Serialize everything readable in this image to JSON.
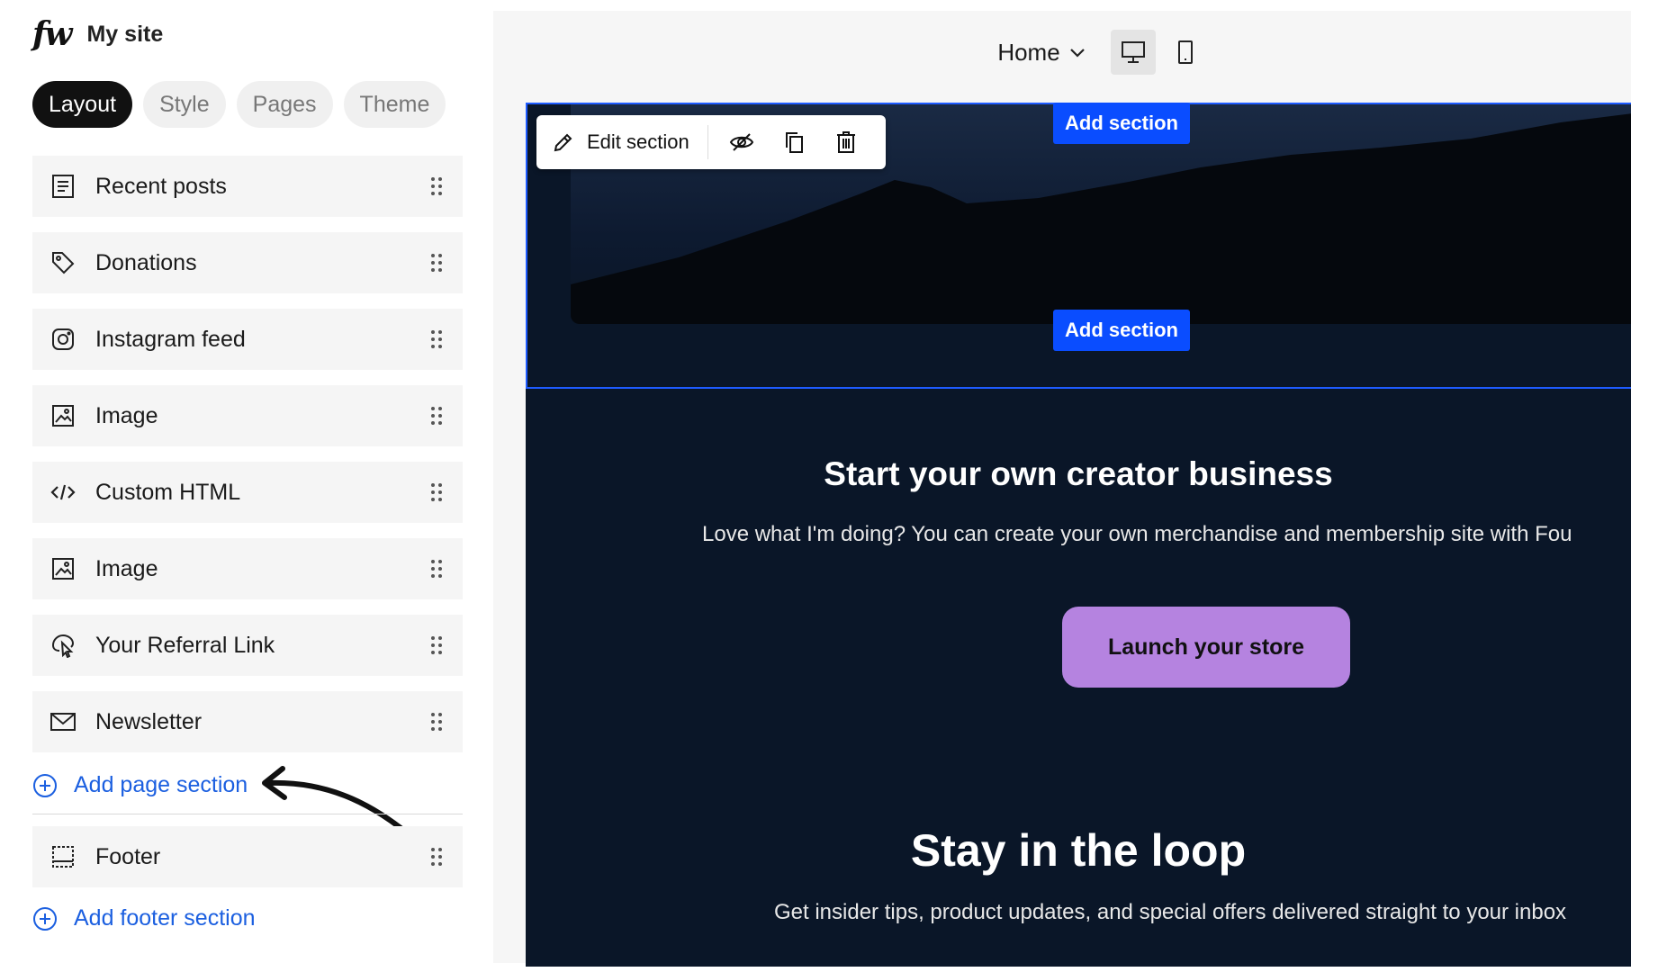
{
  "brand": {
    "logo": "fw",
    "site_name": "My site"
  },
  "tabs": [
    {
      "label": "Layout",
      "active": true
    },
    {
      "label": "Style",
      "active": false
    },
    {
      "label": "Pages",
      "active": false
    },
    {
      "label": "Theme",
      "active": false
    }
  ],
  "sections": [
    {
      "label": "Recent posts",
      "icon": "document-icon"
    },
    {
      "label": "Donations",
      "icon": "tag-icon"
    },
    {
      "label": "Instagram feed",
      "icon": "instagram-icon"
    },
    {
      "label": "Image",
      "icon": "image-icon"
    },
    {
      "label": "Custom HTML",
      "icon": "code-icon"
    },
    {
      "label": "Image",
      "icon": "image-icon"
    },
    {
      "label": "Your Referral Link",
      "icon": "referral-icon"
    },
    {
      "label": "Newsletter",
      "icon": "mail-icon"
    }
  ],
  "add_page_section": "Add page section",
  "footer": {
    "label": "Footer",
    "icon": "footer-icon"
  },
  "add_footer_section": "Add footer section",
  "preview": {
    "page_selector": "Home",
    "devices": [
      "desktop-icon",
      "mobile-icon"
    ],
    "toolbar": {
      "edit_label": "Edit section"
    },
    "add_section_label": "Add section",
    "creator_title": "Start your own creator business",
    "creator_text": "Love what I'm doing? You can create your own merchandise and membership site with Fou",
    "launch_button": "Launch your store",
    "loop_title": "Stay in the loop",
    "loop_text": "Get insider tips, product updates, and special offers delivered straight to your inbox"
  },
  "colors": {
    "accent_blue": "#0a4dff",
    "link_blue": "#1b5fe0",
    "canvas_bg": "#0a1628",
    "launch_purple": "#b583e0",
    "active_tab": "#111111"
  }
}
